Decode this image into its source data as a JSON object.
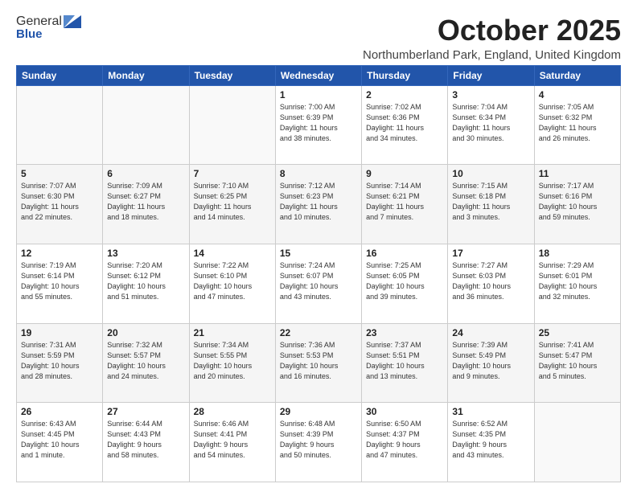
{
  "header": {
    "logo_general": "General",
    "logo_blue": "Blue",
    "month_title": "October 2025",
    "location": "Northumberland Park, England, United Kingdom"
  },
  "weekdays": [
    "Sunday",
    "Monday",
    "Tuesday",
    "Wednesday",
    "Thursday",
    "Friday",
    "Saturday"
  ],
  "weeks": [
    [
      {
        "day": "",
        "info": ""
      },
      {
        "day": "",
        "info": ""
      },
      {
        "day": "",
        "info": ""
      },
      {
        "day": "1",
        "info": "Sunrise: 7:00 AM\nSunset: 6:39 PM\nDaylight: 11 hours\nand 38 minutes."
      },
      {
        "day": "2",
        "info": "Sunrise: 7:02 AM\nSunset: 6:36 PM\nDaylight: 11 hours\nand 34 minutes."
      },
      {
        "day": "3",
        "info": "Sunrise: 7:04 AM\nSunset: 6:34 PM\nDaylight: 11 hours\nand 30 minutes."
      },
      {
        "day": "4",
        "info": "Sunrise: 7:05 AM\nSunset: 6:32 PM\nDaylight: 11 hours\nand 26 minutes."
      }
    ],
    [
      {
        "day": "5",
        "info": "Sunrise: 7:07 AM\nSunset: 6:30 PM\nDaylight: 11 hours\nand 22 minutes."
      },
      {
        "day": "6",
        "info": "Sunrise: 7:09 AM\nSunset: 6:27 PM\nDaylight: 11 hours\nand 18 minutes."
      },
      {
        "day": "7",
        "info": "Sunrise: 7:10 AM\nSunset: 6:25 PM\nDaylight: 11 hours\nand 14 minutes."
      },
      {
        "day": "8",
        "info": "Sunrise: 7:12 AM\nSunset: 6:23 PM\nDaylight: 11 hours\nand 10 minutes."
      },
      {
        "day": "9",
        "info": "Sunrise: 7:14 AM\nSunset: 6:21 PM\nDaylight: 11 hours\nand 7 minutes."
      },
      {
        "day": "10",
        "info": "Sunrise: 7:15 AM\nSunset: 6:18 PM\nDaylight: 11 hours\nand 3 minutes."
      },
      {
        "day": "11",
        "info": "Sunrise: 7:17 AM\nSunset: 6:16 PM\nDaylight: 10 hours\nand 59 minutes."
      }
    ],
    [
      {
        "day": "12",
        "info": "Sunrise: 7:19 AM\nSunset: 6:14 PM\nDaylight: 10 hours\nand 55 minutes."
      },
      {
        "day": "13",
        "info": "Sunrise: 7:20 AM\nSunset: 6:12 PM\nDaylight: 10 hours\nand 51 minutes."
      },
      {
        "day": "14",
        "info": "Sunrise: 7:22 AM\nSunset: 6:10 PM\nDaylight: 10 hours\nand 47 minutes."
      },
      {
        "day": "15",
        "info": "Sunrise: 7:24 AM\nSunset: 6:07 PM\nDaylight: 10 hours\nand 43 minutes."
      },
      {
        "day": "16",
        "info": "Sunrise: 7:25 AM\nSunset: 6:05 PM\nDaylight: 10 hours\nand 39 minutes."
      },
      {
        "day": "17",
        "info": "Sunrise: 7:27 AM\nSunset: 6:03 PM\nDaylight: 10 hours\nand 36 minutes."
      },
      {
        "day": "18",
        "info": "Sunrise: 7:29 AM\nSunset: 6:01 PM\nDaylight: 10 hours\nand 32 minutes."
      }
    ],
    [
      {
        "day": "19",
        "info": "Sunrise: 7:31 AM\nSunset: 5:59 PM\nDaylight: 10 hours\nand 28 minutes."
      },
      {
        "day": "20",
        "info": "Sunrise: 7:32 AM\nSunset: 5:57 PM\nDaylight: 10 hours\nand 24 minutes."
      },
      {
        "day": "21",
        "info": "Sunrise: 7:34 AM\nSunset: 5:55 PM\nDaylight: 10 hours\nand 20 minutes."
      },
      {
        "day": "22",
        "info": "Sunrise: 7:36 AM\nSunset: 5:53 PM\nDaylight: 10 hours\nand 16 minutes."
      },
      {
        "day": "23",
        "info": "Sunrise: 7:37 AM\nSunset: 5:51 PM\nDaylight: 10 hours\nand 13 minutes."
      },
      {
        "day": "24",
        "info": "Sunrise: 7:39 AM\nSunset: 5:49 PM\nDaylight: 10 hours\nand 9 minutes."
      },
      {
        "day": "25",
        "info": "Sunrise: 7:41 AM\nSunset: 5:47 PM\nDaylight: 10 hours\nand 5 minutes."
      }
    ],
    [
      {
        "day": "26",
        "info": "Sunrise: 6:43 AM\nSunset: 4:45 PM\nDaylight: 10 hours\nand 1 minute."
      },
      {
        "day": "27",
        "info": "Sunrise: 6:44 AM\nSunset: 4:43 PM\nDaylight: 9 hours\nand 58 minutes."
      },
      {
        "day": "28",
        "info": "Sunrise: 6:46 AM\nSunset: 4:41 PM\nDaylight: 9 hours\nand 54 minutes."
      },
      {
        "day": "29",
        "info": "Sunrise: 6:48 AM\nSunset: 4:39 PM\nDaylight: 9 hours\nand 50 minutes."
      },
      {
        "day": "30",
        "info": "Sunrise: 6:50 AM\nSunset: 4:37 PM\nDaylight: 9 hours\nand 47 minutes."
      },
      {
        "day": "31",
        "info": "Sunrise: 6:52 AM\nSunset: 4:35 PM\nDaylight: 9 hours\nand 43 minutes."
      },
      {
        "day": "",
        "info": ""
      }
    ]
  ]
}
